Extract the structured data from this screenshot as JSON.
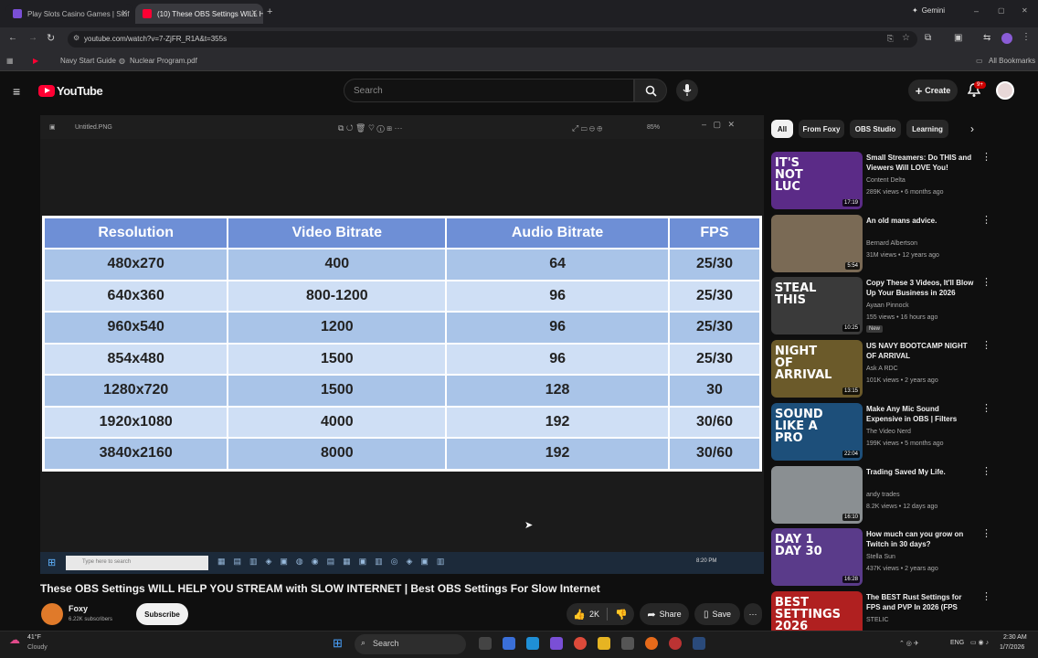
{
  "browser": {
    "tabs": [
      {
        "title": "Play Slots Casino Games | Stuf"
      },
      {
        "title": "(10) These OBS Settings WILL H"
      }
    ],
    "gemini_label": "Gemini",
    "url": "youtube.com/watch?v=7-ZjFR_R1A&t=355s",
    "bookmarks": [
      "Navy Start Guide",
      "Nuclear Program.pdf"
    ],
    "all_bookmarks": "All Bookmarks"
  },
  "youtube": {
    "logo_text": "YouTube",
    "search_placeholder": "Search",
    "create_label": "Create",
    "notif_count": "9+"
  },
  "video": {
    "viewer_filename": "Untitled.PNG",
    "viewer_zoom": "85%",
    "table": {
      "headers": [
        "Resolution",
        "Video Bitrate",
        "Audio Bitrate",
        "FPS"
      ],
      "rows": [
        [
          "480x270",
          "400",
          "64",
          "25/30"
        ],
        [
          "640x360",
          "800-1200",
          "96",
          "25/30"
        ],
        [
          "960x540",
          "1200",
          "96",
          "25/30"
        ],
        [
          "854x480",
          "1500",
          "96",
          "25/30"
        ],
        [
          "1280x720",
          "1500",
          "128",
          "30"
        ],
        [
          "1920x1080",
          "4000",
          "192",
          "30/60"
        ],
        [
          "3840x2160",
          "8000",
          "192",
          "30/60"
        ]
      ]
    },
    "inner_taskbar_search": "Type here to search",
    "inner_clock": "8:20 PM",
    "title": "These OBS Settings WILL HELP YOU STREAM with SLOW INTERNET | Best OBS Settings For Slow Internet",
    "channel": "Foxy",
    "subscribers": "6.22K subscribers",
    "subscribe_label": "Subscribe",
    "likes": "2K",
    "share_label": "Share",
    "save_label": "Save"
  },
  "sidebar": {
    "chips": [
      "All",
      "From Foxy",
      "OBS Studio",
      "Learning"
    ],
    "videos": [
      {
        "title": "Small Streamers: Do THIS and Viewers Will LOVE You!",
        "channel": "Content Delta",
        "meta": "289K views • 6 months ago",
        "duration": "17:19",
        "thumb_text": "IT'S NOT LUC",
        "thumb_color": "#5b2b87"
      },
      {
        "title": "An old mans advice.",
        "channel": "Bernard Albertson",
        "meta": "31M views • 12 years ago",
        "duration": "5:54",
        "thumb_text": "",
        "thumb_color": "#7a6a55"
      },
      {
        "title": "Copy These 3 Videos, It'll Blow Up Your Business in 2026",
        "channel": "Ayaan Pinnock",
        "meta": "155 views • 16 hours ago",
        "duration": "10:25",
        "thumb_text": "STEAL THIS",
        "thumb_color": "#3a3a3a",
        "badge": "New"
      },
      {
        "title": "US NAVY BOOTCAMP NIGHT OF ARRIVAL",
        "channel": "Ask A RDC",
        "meta": "101K views • 2 years ago",
        "duration": "13:15",
        "thumb_text": "NIGHT OF ARRIVAL",
        "thumb_color": "#6b5a2a"
      },
      {
        "title": "Make Any Mic Sound Expensive in OBS | Filters Tutorial 2025",
        "channel": "The Video Nerd",
        "meta": "199K views • 5 months ago",
        "duration": "22:04",
        "thumb_text": "SOUND LIKE A PRO",
        "thumb_color": "#1d4f7a"
      },
      {
        "title": "Trading Saved My Life.",
        "channel": "andy trades",
        "meta": "8.2K views • 12 days ago",
        "duration": "16:10",
        "thumb_text": "",
        "thumb_color": "#8a8f92"
      },
      {
        "title": "How much can you grow on Twitch in 30 days?",
        "channel": "Stella Sun",
        "meta": "437K views • 2 years ago",
        "duration": "16:28",
        "thumb_text": "DAY 1  DAY 30",
        "thumb_color": "#5a3b8a"
      },
      {
        "title": "The BEST Rust Settings for FPS and PVP In 2026 (FPS Boost, ...",
        "channel": "STELIC",
        "meta": "",
        "duration": "",
        "thumb_text": "BEST SETTINGS 2026",
        "thumb_color": "#b02020"
      }
    ]
  },
  "os": {
    "weather_temp": "41°F",
    "weather_desc": "Cloudy",
    "search_label": "Search",
    "lang": "ENG",
    "time": "2:30 AM",
    "date": "1/7/2026"
  },
  "colors": {
    "table_header": "#6e8fd6",
    "row_dark": "#a9c4e8",
    "row_light": "#cfdff5",
    "yt_red": "#ff0033"
  }
}
